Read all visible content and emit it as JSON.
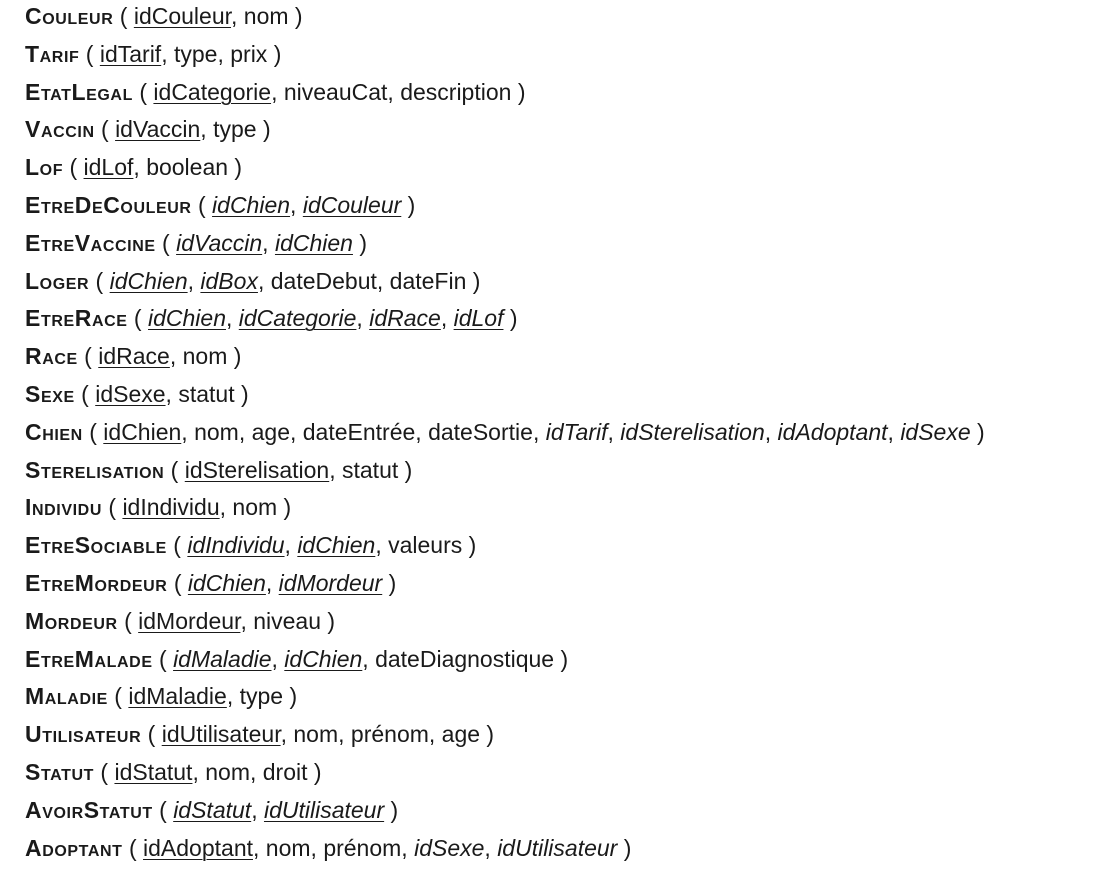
{
  "relations": [
    {
      "name": "Couleur",
      "attributes": [
        {
          "text": "idCouleur",
          "pk": true,
          "fk": false
        },
        {
          "text": "nom",
          "pk": false,
          "fk": false
        }
      ]
    },
    {
      "name": "Tarif",
      "attributes": [
        {
          "text": "idTarif",
          "pk": true,
          "fk": false
        },
        {
          "text": "type",
          "pk": false,
          "fk": false
        },
        {
          "text": "prix",
          "pk": false,
          "fk": false
        }
      ]
    },
    {
      "name": "EtatLegal",
      "attributes": [
        {
          "text": "idCategorie",
          "pk": true,
          "fk": false
        },
        {
          "text": "niveauCat",
          "pk": false,
          "fk": false
        },
        {
          "text": "description",
          "pk": false,
          "fk": false
        }
      ]
    },
    {
      "name": "Vaccin",
      "attributes": [
        {
          "text": "idVaccin",
          "pk": true,
          "fk": false
        },
        {
          "text": "type",
          "pk": false,
          "fk": false
        }
      ]
    },
    {
      "name": "Lof",
      "attributes": [
        {
          "text": "idLof",
          "pk": true,
          "fk": false
        },
        {
          "text": "boolean",
          "pk": false,
          "fk": false
        }
      ]
    },
    {
      "name": "EtreDeCouleur",
      "attributes": [
        {
          "text": "idChien",
          "pk": true,
          "fk": true
        },
        {
          "text": "idCouleur",
          "pk": true,
          "fk": true
        }
      ]
    },
    {
      "name": "EtreVaccine",
      "attributes": [
        {
          "text": "idVaccin",
          "pk": true,
          "fk": true
        },
        {
          "text": "idChien",
          "pk": true,
          "fk": true
        }
      ]
    },
    {
      "name": "Loger",
      "attributes": [
        {
          "text": "idChien",
          "pk": true,
          "fk": true
        },
        {
          "text": "idBox",
          "pk": true,
          "fk": true
        },
        {
          "text": "dateDebut",
          "pk": false,
          "fk": false
        },
        {
          "text": "dateFin",
          "pk": false,
          "fk": false
        }
      ]
    },
    {
      "name": "EtreRace",
      "attributes": [
        {
          "text": "idChien",
          "pk": true,
          "fk": true
        },
        {
          "text": "idCategorie",
          "pk": true,
          "fk": true
        },
        {
          "text": "idRace",
          "pk": true,
          "fk": true
        },
        {
          "text": "idLof",
          "pk": true,
          "fk": true
        }
      ]
    },
    {
      "name": "Race",
      "attributes": [
        {
          "text": "idRace",
          "pk": true,
          "fk": false
        },
        {
          "text": "nom",
          "pk": false,
          "fk": false
        }
      ]
    },
    {
      "name": "Sexe",
      "attributes": [
        {
          "text": "idSexe",
          "pk": true,
          "fk": false
        },
        {
          "text": "statut",
          "pk": false,
          "fk": false
        }
      ]
    },
    {
      "name": "Chien",
      "attributes": [
        {
          "text": "idChien",
          "pk": true,
          "fk": false
        },
        {
          "text": "nom",
          "pk": false,
          "fk": false
        },
        {
          "text": "age",
          "pk": false,
          "fk": false
        },
        {
          "text": "dateEntrée",
          "pk": false,
          "fk": false
        },
        {
          "text": "dateSortie",
          "pk": false,
          "fk": false
        },
        {
          "text": "idTarif",
          "pk": false,
          "fk": true
        },
        {
          "text": "idSterelisation",
          "pk": false,
          "fk": true
        },
        {
          "text": "idAdoptant",
          "pk": false,
          "fk": true
        },
        {
          "text": "idSexe",
          "pk": false,
          "fk": true
        }
      ]
    },
    {
      "name": "Sterelisation",
      "attributes": [
        {
          "text": "idSterelisation",
          "pk": true,
          "fk": false
        },
        {
          "text": "statut",
          "pk": false,
          "fk": false
        }
      ]
    },
    {
      "name": "Individu",
      "attributes": [
        {
          "text": "idIndividu",
          "pk": true,
          "fk": false
        },
        {
          "text": "nom",
          "pk": false,
          "fk": false
        }
      ]
    },
    {
      "name": "EtreSociable",
      "attributes": [
        {
          "text": "idIndividu",
          "pk": true,
          "fk": true
        },
        {
          "text": "idChien",
          "pk": true,
          "fk": true
        },
        {
          "text": "valeurs",
          "pk": false,
          "fk": false
        }
      ]
    },
    {
      "name": "EtreMordeur",
      "attributes": [
        {
          "text": "idChien",
          "pk": true,
          "fk": true
        },
        {
          "text": "idMordeur",
          "pk": true,
          "fk": true
        }
      ]
    },
    {
      "name": "Mordeur",
      "attributes": [
        {
          "text": "idMordeur",
          "pk": true,
          "fk": false
        },
        {
          "text": "niveau",
          "pk": false,
          "fk": false
        }
      ]
    },
    {
      "name": "EtreMalade",
      "attributes": [
        {
          "text": "idMaladie",
          "pk": true,
          "fk": true
        },
        {
          "text": "idChien",
          "pk": true,
          "fk": true
        },
        {
          "text": "dateDiagnostique",
          "pk": false,
          "fk": false
        }
      ]
    },
    {
      "name": "Maladie",
      "attributes": [
        {
          "text": "idMaladie",
          "pk": true,
          "fk": false
        },
        {
          "text": "type",
          "pk": false,
          "fk": false
        }
      ]
    },
    {
      "name": "Utilisateur",
      "attributes": [
        {
          "text": "idUtilisateur",
          "pk": true,
          "fk": false
        },
        {
          "text": "nom",
          "pk": false,
          "fk": false
        },
        {
          "text": "prénom",
          "pk": false,
          "fk": false
        },
        {
          "text": "age",
          "pk": false,
          "fk": false
        }
      ]
    },
    {
      "name": "Statut",
      "attributes": [
        {
          "text": "idStatut",
          "pk": true,
          "fk": false
        },
        {
          "text": "nom",
          "pk": false,
          "fk": false
        },
        {
          "text": "droit",
          "pk": false,
          "fk": false
        }
      ]
    },
    {
      "name": "AvoirStatut",
      "attributes": [
        {
          "text": "idStatut",
          "pk": true,
          "fk": true
        },
        {
          "text": "idUtilisateur",
          "pk": true,
          "fk": true
        }
      ]
    },
    {
      "name": "Adoptant",
      "attributes": [
        {
          "text": "idAdoptant",
          "pk": true,
          "fk": false
        },
        {
          "text": "nom",
          "pk": false,
          "fk": false
        },
        {
          "text": "prénom",
          "pk": false,
          "fk": false
        },
        {
          "text": "idSexe",
          "pk": false,
          "fk": true
        },
        {
          "text": "idUtilisateur",
          "pk": false,
          "fk": true
        }
      ]
    }
  ]
}
